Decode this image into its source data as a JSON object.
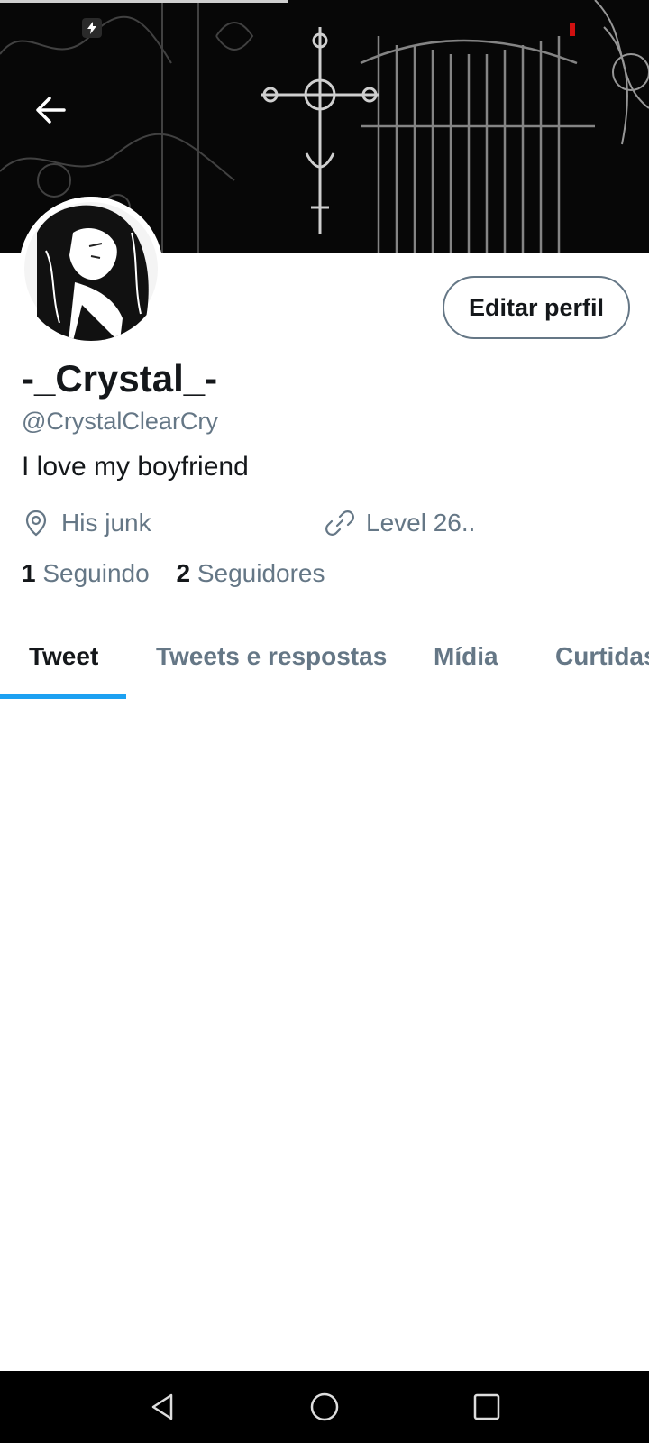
{
  "header": {
    "back_icon": "arrow-left-icon",
    "status_icon": "lightning-icon"
  },
  "profile": {
    "display_name": "-_Crystal_-",
    "handle": "@CrystalClearCry",
    "bio": "I love my boyfriend",
    "edit_button_label": "Editar perfil",
    "location_icon": "location-pin-icon",
    "location": "His junk",
    "link_icon": "link-icon",
    "link": "Level 26..",
    "following_count": "1",
    "following_label": "Seguindo",
    "followers_count": "2",
    "followers_label": "Seguidores"
  },
  "tabs": [
    {
      "label": "Tweet",
      "active": true
    },
    {
      "label": "Tweets e respostas",
      "active": false
    },
    {
      "label": "Mídia",
      "active": false
    },
    {
      "label": "Curtidas",
      "active": false
    }
  ],
  "nav": {
    "back_icon": "triangle-back-icon",
    "home_icon": "circle-home-icon",
    "recents_icon": "square-recents-icon"
  },
  "colors": {
    "accent": "#1da1f2",
    "text_primary": "#14171a",
    "text_secondary": "#657786"
  }
}
